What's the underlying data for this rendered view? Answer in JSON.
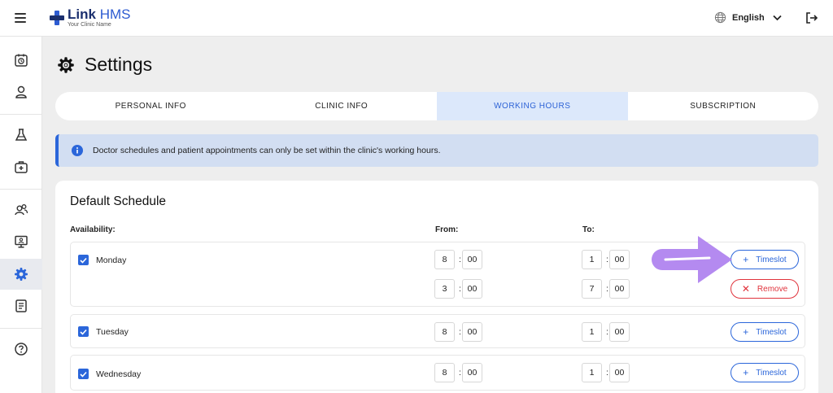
{
  "header": {
    "brand_bold": "Link",
    "brand_light": "HMS",
    "brand_sub": "Your Clinic Name",
    "language": "English"
  },
  "sidebar": {
    "items": [
      {
        "name": "appointments-icon"
      },
      {
        "name": "profile-icon"
      },
      {
        "name": "lab-icon"
      },
      {
        "name": "medical-kit-icon"
      },
      {
        "name": "patients-icon"
      },
      {
        "name": "monitor-icon"
      },
      {
        "name": "settings-icon",
        "active": true
      },
      {
        "name": "report-icon"
      },
      {
        "name": "help-icon"
      }
    ]
  },
  "page": {
    "title": "Settings"
  },
  "tabs": [
    {
      "label": "PERSONAL INFO"
    },
    {
      "label": "CLINIC INFO"
    },
    {
      "label": "WORKING HOURS",
      "active": true
    },
    {
      "label": "SUBSCRIPTION"
    }
  ],
  "banner": {
    "text": "Doctor schedules and patient appointments can only be set within the clinic's working hours."
  },
  "schedule": {
    "title": "Default Schedule",
    "availability_label": "Availability:",
    "from_label": "From:",
    "to_label": "To:",
    "add_label": "Timeslot",
    "remove_label": "Remove",
    "days": [
      {
        "name": "Monday",
        "checked": true,
        "slots": [
          {
            "from_h": "8",
            "from_m": "00",
            "to_h": "1",
            "to_m": "00"
          },
          {
            "from_h": "3",
            "from_m": "00",
            "to_h": "7",
            "to_m": "00"
          }
        ]
      },
      {
        "name": "Tuesday",
        "checked": true,
        "slots": [
          {
            "from_h": "8",
            "from_m": "00",
            "to_h": "1",
            "to_m": "00"
          }
        ]
      },
      {
        "name": "Wednesday",
        "checked": true,
        "slots": [
          {
            "from_h": "8",
            "from_m": "00",
            "to_h": "1",
            "to_m": "00"
          }
        ]
      }
    ]
  },
  "colors": {
    "accent": "#2b66da",
    "danger": "#e0333c",
    "arrow": "#b48af0",
    "tab_active_bg": "#dce8fb",
    "banner_bg": "#d2def2"
  }
}
